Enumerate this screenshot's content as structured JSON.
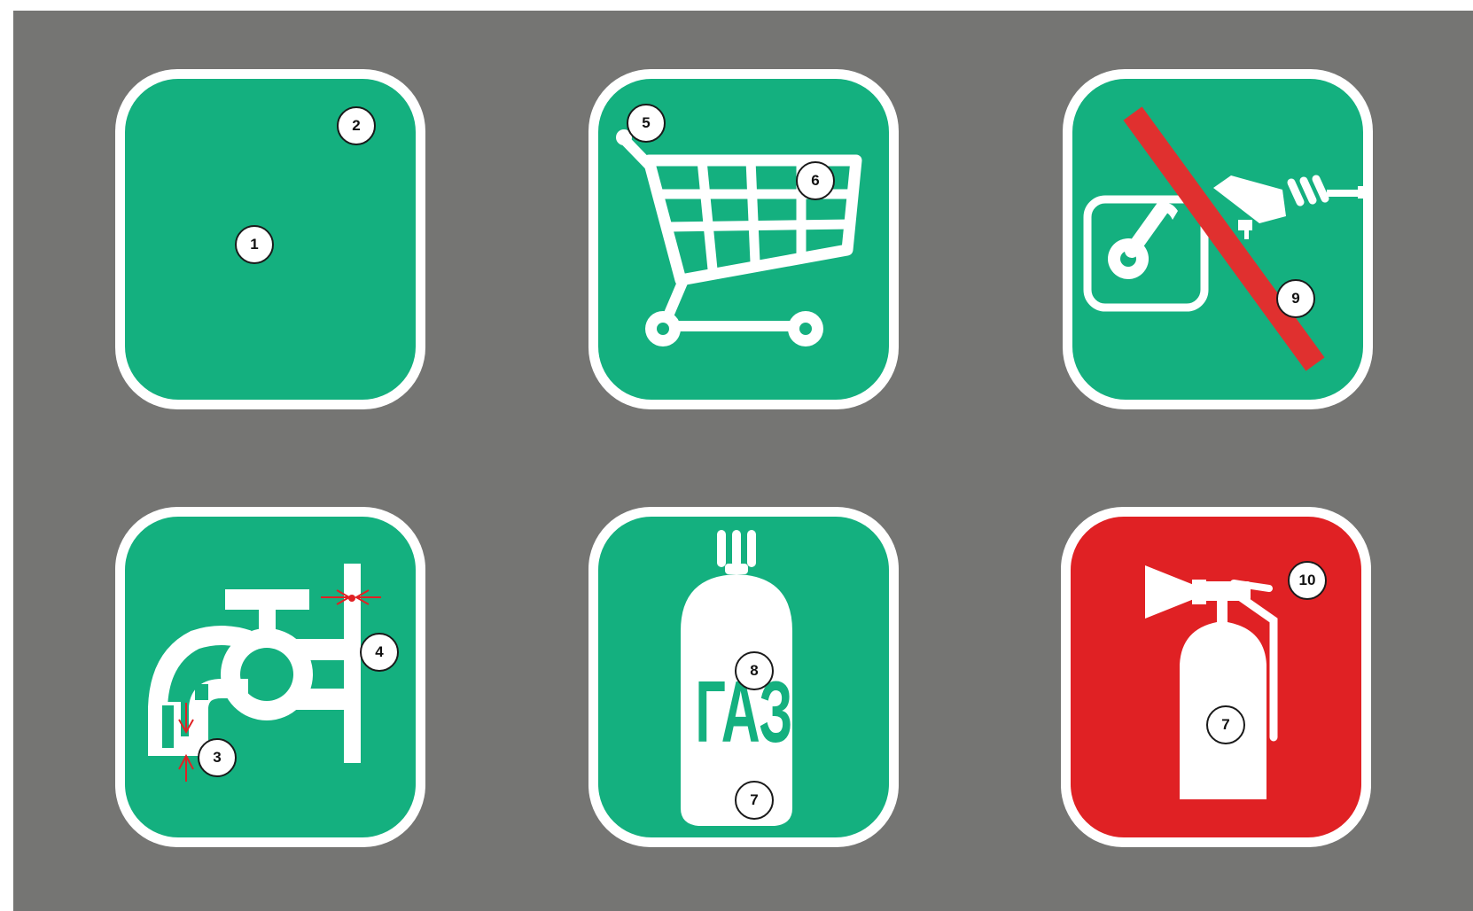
{
  "colors": {
    "background": "#757573",
    "sign_green": "#14b07f",
    "sign_red": "#e02124",
    "border_white": "#ffffff",
    "prohibition_red": "#e0302f",
    "dimension_red": "#e02124"
  },
  "signs": [
    {
      "id": "blank",
      "icon": "blank-sign",
      "background": "green",
      "callouts": [
        "1",
        "2"
      ]
    },
    {
      "id": "cart",
      "icon": "shopping-cart-icon",
      "background": "green",
      "callouts": [
        "5",
        "6"
      ]
    },
    {
      "id": "no-camera",
      "icon": "no-photo-video-icon",
      "background": "green",
      "callouts": [
        "9"
      ]
    },
    {
      "id": "tap",
      "icon": "water-tap-icon",
      "background": "green",
      "callouts": [
        "3",
        "4"
      ]
    },
    {
      "id": "gas",
      "icon": "gas-cylinder-icon",
      "background": "green",
      "text": "ГАЗ",
      "callouts": [
        "8",
        "7"
      ]
    },
    {
      "id": "extinguisher",
      "icon": "fire-extinguisher-icon",
      "background": "red",
      "callouts": [
        "10",
        "7"
      ]
    }
  ]
}
